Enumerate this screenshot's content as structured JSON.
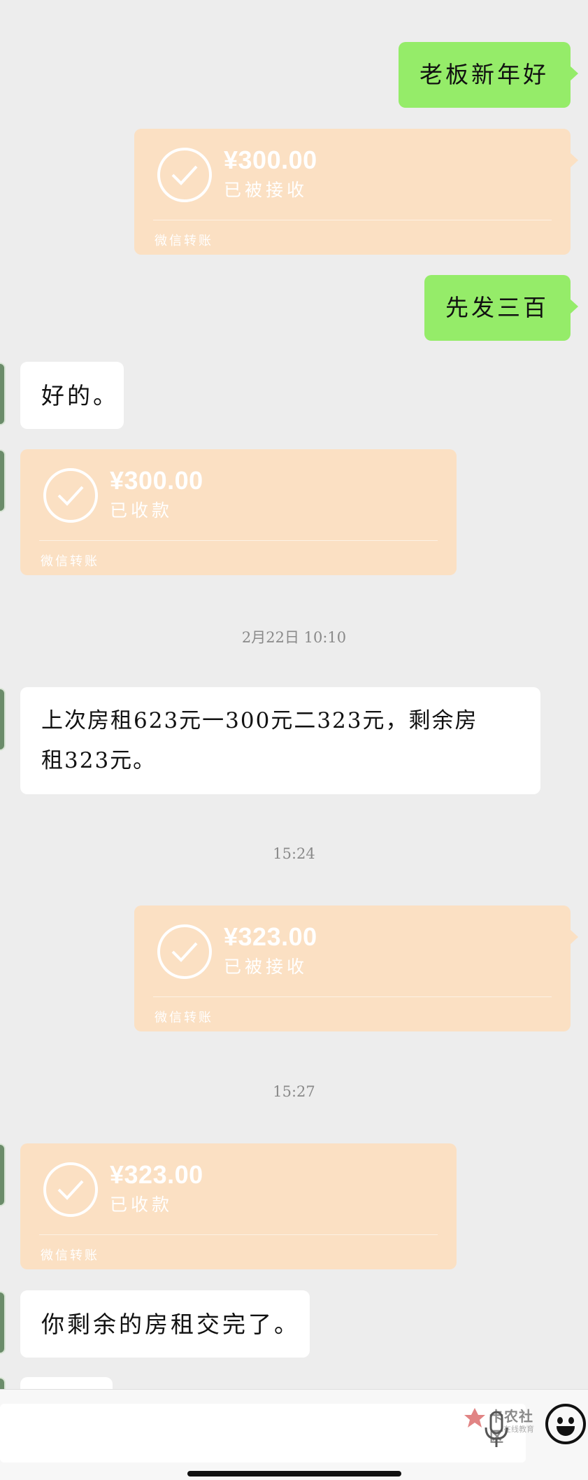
{
  "messages": {
    "m1": {
      "text": "老板新年好"
    },
    "t1": {
      "amount": "¥300.00",
      "status": "已被接收",
      "footer": "微信转账"
    },
    "m2": {
      "text": "先发三百"
    },
    "m3": {
      "text": "好的。"
    },
    "t2": {
      "amount": "¥300.00",
      "status": "已收款",
      "footer": "微信转账"
    },
    "ts1": "2月22日 10:10",
    "m4": {
      "line1": "上次房租623元一300元二323元，剩余房",
      "line2": "租323元。"
    },
    "ts2": "15:24",
    "t3": {
      "amount": "¥323.00",
      "status": "已被接收",
      "footer": "微信转账"
    },
    "ts3": "15:27",
    "t4": {
      "amount": "¥323.00",
      "status": "已收款",
      "footer": "微信转账"
    },
    "m5": {
      "text": "你剩余的房租交完了。"
    }
  },
  "input_bar": {
    "watermark_title": "卡农社区",
    "watermark_sub": "在线教育",
    "mic_icon": "microphone-icon",
    "emoji_icon": "smiley-face-icon"
  },
  "colors": {
    "background": "#ededed",
    "sent_bubble": "#95ec69",
    "received_bubble": "#ffffff",
    "transfer_card": "#fbe0c3"
  }
}
